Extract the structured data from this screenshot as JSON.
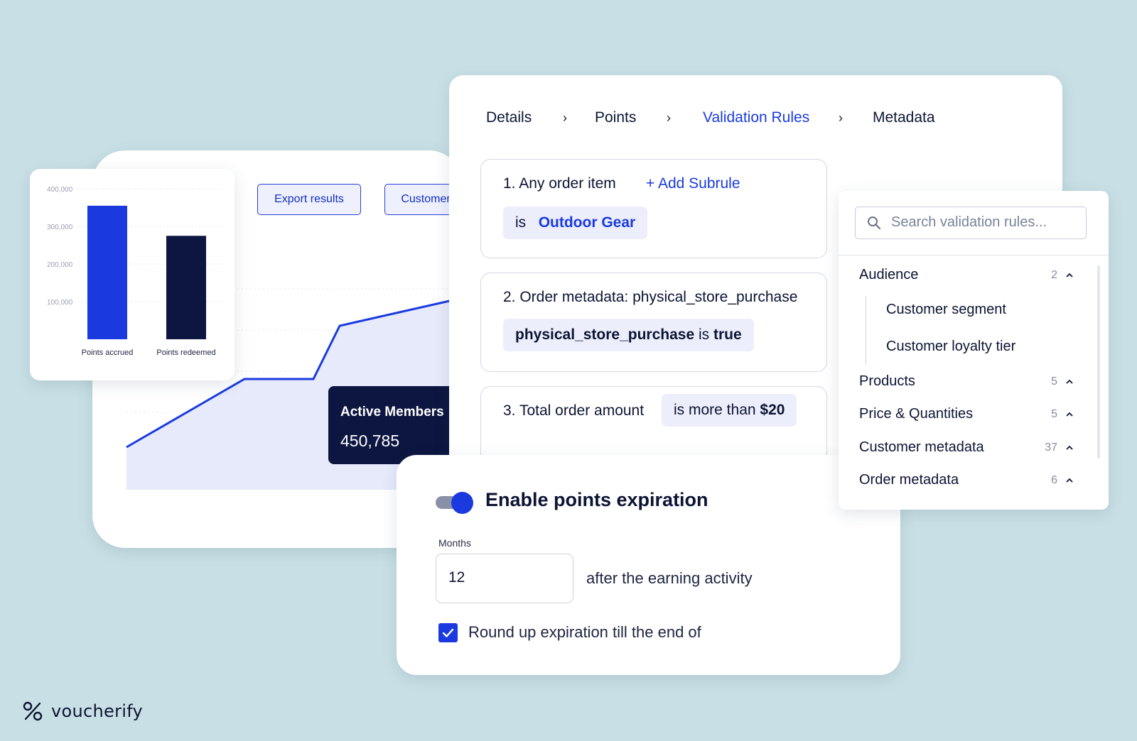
{
  "analytics": {
    "export_button": "Export results",
    "customer_button": "Customer",
    "tooltip_title": "Active Members",
    "tooltip_value": "450,785",
    "accent_color": "#1a3ae0"
  },
  "chart_data": {
    "type": "bar",
    "categories": [
      "Points accrued",
      "Points redeemed"
    ],
    "series": [
      {
        "values": [
          355000,
          275000
        ]
      }
    ],
    "colors": [
      "#1a3ae0",
      "#0d1640"
    ],
    "yticks": [
      "100,000",
      "200,000",
      "300,000",
      "400,000"
    ],
    "ylim": [
      0,
      400000
    ],
    "grid": true
  },
  "breadcrumb": {
    "items": [
      {
        "label": "Details"
      },
      {
        "label": "Points"
      },
      {
        "label": "Validation Rules"
      },
      {
        "label": "Metadata"
      }
    ],
    "separator": "›"
  },
  "rules": [
    {
      "title": "1. Any order item",
      "add": "+  Add Subrule",
      "chip_prefix": "is",
      "chip_value": "Outdoor Gear"
    },
    {
      "title": "2. Order metadata: physical_store_purchase",
      "chip_key": "physical_store_purchase",
      "chip_op": "is",
      "chip_val": "true"
    },
    {
      "title": "3. Total order amount",
      "chip_op": "is more than",
      "chip_val": "$20"
    }
  ],
  "expiration": {
    "title": "Enable points expiration",
    "enabled": true,
    "months_label": "Months",
    "months_value": "12",
    "after_text": "after the earning activity",
    "round_checked": true,
    "round_text": "Round up expiration till the end of"
  },
  "search": {
    "placeholder": "Search validation rules...",
    "categories": [
      {
        "label": "Audience",
        "count": "2"
      },
      {
        "label": "Products",
        "count": "5"
      },
      {
        "label": "Price & Quantities",
        "count": "5"
      },
      {
        "label": "Customer metadata",
        "count": "37"
      },
      {
        "label": "Order metadata",
        "count": "6"
      }
    ],
    "audience_items": [
      {
        "label": "Customer segment"
      },
      {
        "label": "Customer loyalty tier"
      }
    ]
  },
  "logo": {
    "text": "voucherify"
  }
}
